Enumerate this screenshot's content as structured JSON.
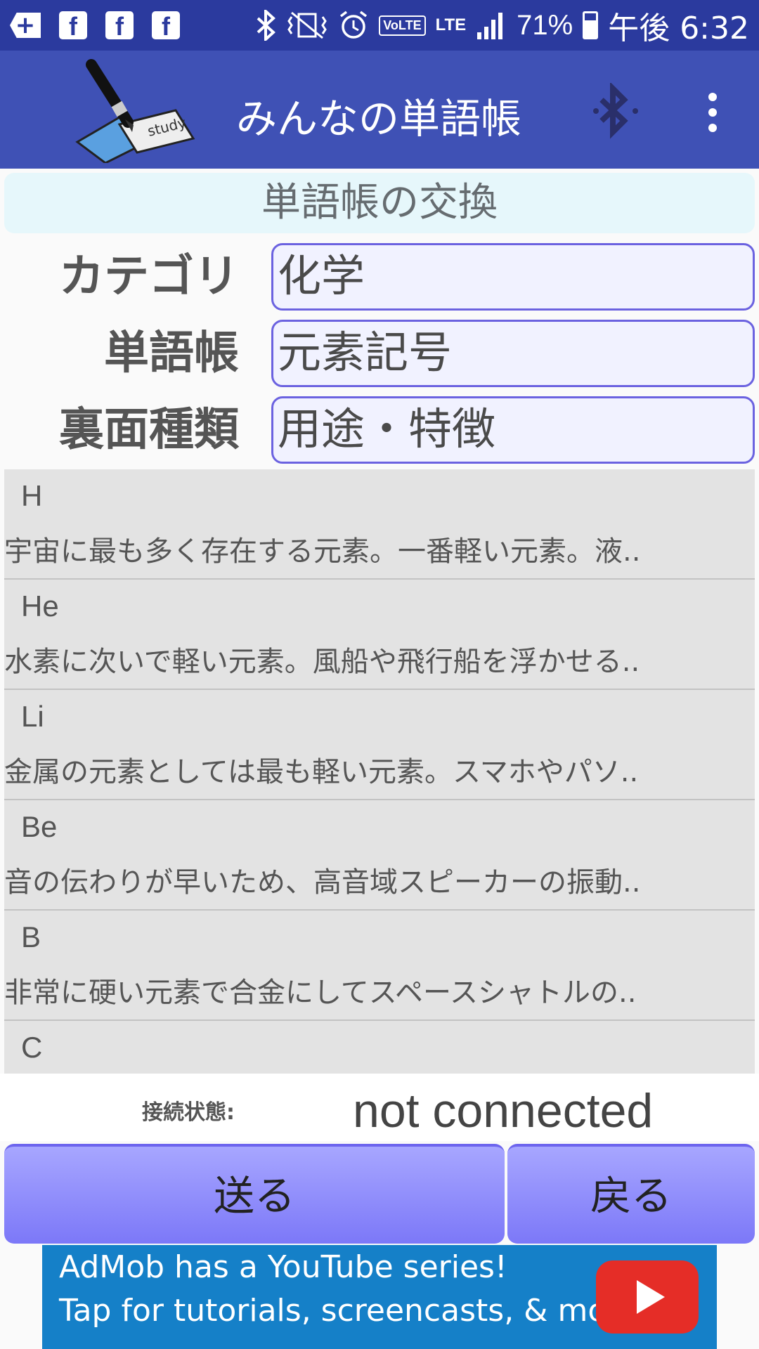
{
  "status_bar": {
    "battery_text": "71%",
    "battery_level": 0.71,
    "time": "午後 6:32",
    "network": "LTE",
    "volte": "VoLTE",
    "icons": [
      "plus-icon",
      "facebook-icon",
      "facebook-icon",
      "facebook-icon",
      "bluetooth-icon",
      "vibrate-icon",
      "alarm-icon",
      "volte-icon",
      "lte-icon",
      "signal-icon",
      "battery-icon"
    ]
  },
  "app_bar": {
    "title": "みんなの単語帳",
    "logo_word": "study",
    "icons": [
      "pen-logo-icon",
      "bluetooth-icon",
      "overflow-menu-icon"
    ]
  },
  "section": {
    "title": "単語帳の交換"
  },
  "form": {
    "category_label": "カテゴリ",
    "category_value": "化学",
    "wordbook_label": "単語帳",
    "wordbook_value": "元素記号",
    "back_type_label": "裏面種類",
    "back_type_value": "用途・特徴"
  },
  "list": {
    "items": [
      {
        "symbol": "H",
        "desc": "宇宙に最も多く存在する元素。一番軽い元素。液.."
      },
      {
        "symbol": "He",
        "desc": "水素に次いで軽い元素。風船や飛行船を浮かせる.."
      },
      {
        "symbol": "Li",
        "desc": "金属の元素としては最も軽い元素。スマホやパソ.."
      },
      {
        "symbol": "Be",
        "desc": "音の伝わりが早いため、高音域スピーカーの振動.."
      },
      {
        "symbol": "B",
        "desc": "非常に硬い元素で合金にしてスペースシャトルの.."
      },
      {
        "symbol": "C",
        "desc": ""
      }
    ]
  },
  "connection": {
    "label": "接続状態:",
    "value": "not connected"
  },
  "buttons": {
    "send": "送る",
    "back": "戻る"
  },
  "ad": {
    "line1": "AdMob has a YouTube series!",
    "line2": "Tap for tutorials, screencasts, & more.",
    "icon": "youtube-play-icon"
  },
  "colors": {
    "status_bar": "#2b3a9e",
    "app_bar": "#3f51b5",
    "field_border": "#6b62e0",
    "button": "#8f8cfb",
    "ad": "#1580c8"
  }
}
